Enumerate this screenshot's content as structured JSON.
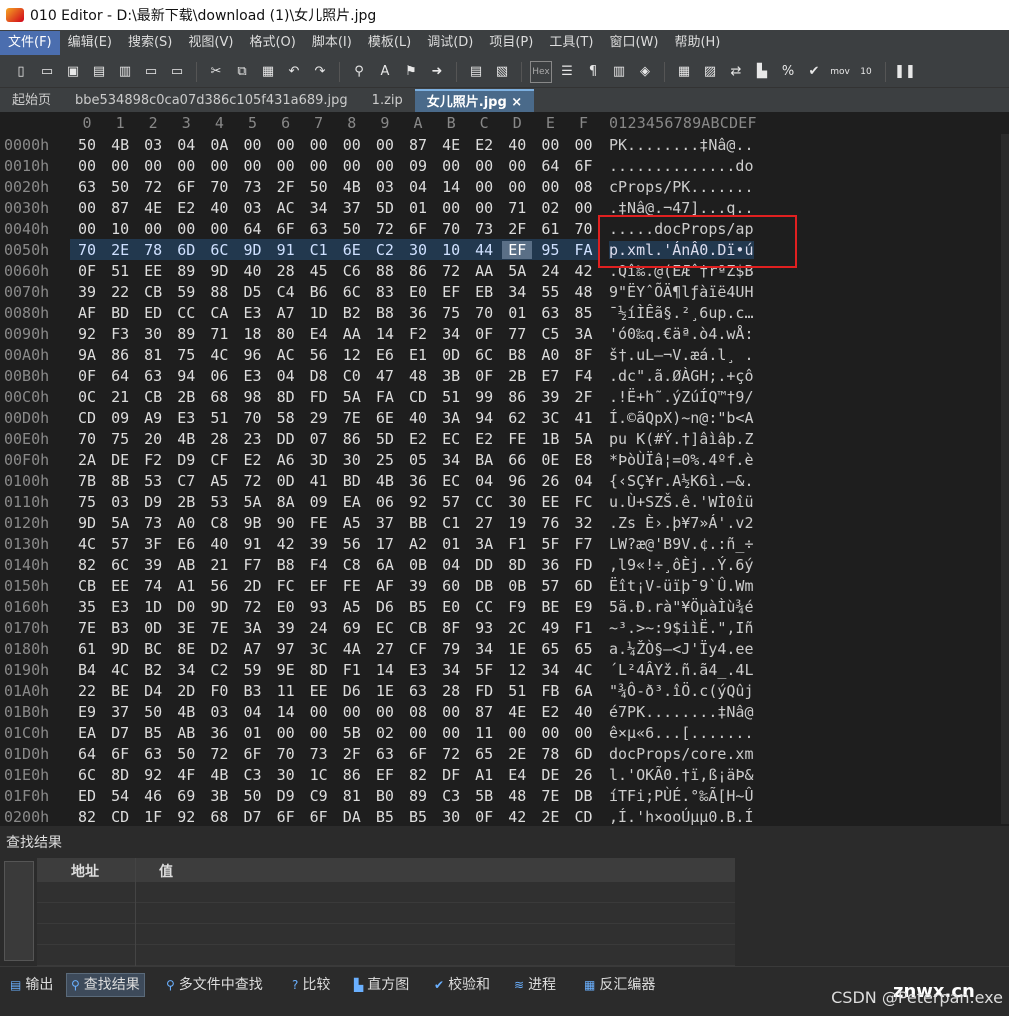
{
  "window_title": "010 Editor - D:\\最新下载\\download (1)\\女儿照片.jpg",
  "menu": [
    "文件(F)",
    "编辑(E)",
    "搜索(S)",
    "视图(V)",
    "格式(O)",
    "脚本(I)",
    "模板(L)",
    "调试(D)",
    "项目(P)",
    "工具(T)",
    "窗口(W)",
    "帮助(H)"
  ],
  "tabs": [
    "起始页",
    "bbe534898c0ca07d386c105f431a689.jpg",
    "1.zip",
    "女儿照片.jpg ×"
  ],
  "column_headers": [
    "0",
    "1",
    "2",
    "3",
    "4",
    "5",
    "6",
    "7",
    "8",
    "9",
    "A",
    "B",
    "C",
    "D",
    "E",
    "F"
  ],
  "ascii_header": "0123456789ABCDEF",
  "rows": [
    {
      "addr": "0000h",
      "hex": [
        "50",
        "4B",
        "03",
        "04",
        "0A",
        "00",
        "00",
        "00",
        "00",
        "00",
        "87",
        "4E",
        "E2",
        "40",
        "00",
        "00"
      ],
      "ascii": "PK........‡Nâ@.."
    },
    {
      "addr": "0010h",
      "hex": [
        "00",
        "00",
        "00",
        "00",
        "00",
        "00",
        "00",
        "00",
        "00",
        "00",
        "09",
        "00",
        "00",
        "00",
        "64",
        "6F"
      ],
      "ascii": "..............do"
    },
    {
      "addr": "0020h",
      "hex": [
        "63",
        "50",
        "72",
        "6F",
        "70",
        "73",
        "2F",
        "50",
        "4B",
        "03",
        "04",
        "14",
        "00",
        "00",
        "00",
        "08"
      ],
      "ascii": "cProps/PK......."
    },
    {
      "addr": "0030h",
      "hex": [
        "00",
        "87",
        "4E",
        "E2",
        "40",
        "03",
        "AC",
        "34",
        "37",
        "5D",
        "01",
        "00",
        "00",
        "71",
        "02",
        "00"
      ],
      "ascii": ".‡Nâ@.¬47]...q.."
    },
    {
      "addr": "0040h",
      "hex": [
        "00",
        "10",
        "00",
        "00",
        "00",
        "64",
        "6F",
        "63",
        "50",
        "72",
        "6F",
        "70",
        "73",
        "2F",
        "61",
        "70"
      ],
      "ascii": ".....docProps/ap"
    },
    {
      "addr": "0050h",
      "hex": [
        "70",
        "2E",
        "78",
        "6D",
        "6C",
        "9D",
        "91",
        "C1",
        "6E",
        "C2",
        "30",
        "10",
        "44",
        "EF",
        "95",
        "FA"
      ],
      "ascii": "p.xml.'ÁnÂ0.Dï•ú"
    },
    {
      "addr": "0060h",
      "hex": [
        "0F",
        "51",
        "EE",
        "89",
        "9D",
        "40",
        "28",
        "45",
        "C6",
        "88",
        "86",
        "72",
        "AA",
        "5A",
        "24",
        "42"
      ],
      "ascii": ".Qî‰.@(EÆˆ†rªZ$B"
    },
    {
      "addr": "0070h",
      "hex": [
        "39",
        "22",
        "CB",
        "59",
        "88",
        "D5",
        "C4",
        "B6",
        "6C",
        "83",
        "E0",
        "EF",
        "EB",
        "34",
        "55",
        "48"
      ],
      "ascii": "9\"ËYˆÕÄ¶lƒàïë4UH"
    },
    {
      "addr": "0080h",
      "hex": [
        "AF",
        "BD",
        "ED",
        "CC",
        "CA",
        "E3",
        "A7",
        "1D",
        "B2",
        "B8",
        "36",
        "75",
        "70",
        "01",
        "63",
        "85"
      ],
      "ascii": "¯½íÌÊã§.²¸6up.c…"
    },
    {
      "addr": "0090h",
      "hex": [
        "92",
        "F3",
        "30",
        "89",
        "71",
        "18",
        "80",
        "E4",
        "AA",
        "14",
        "F2",
        "34",
        "0F",
        "77",
        "C5",
        "3A"
      ],
      "ascii": "'ó0‰q.€äª.ò4.wÅ:"
    },
    {
      "addr": "00A0h",
      "hex": [
        "9A",
        "86",
        "81",
        "75",
        "4C",
        "96",
        "AC",
        "56",
        "12",
        "E6",
        "E1",
        "0D",
        "6C",
        "B8",
        "A0",
        "8F"
      ],
      "ascii": "š†.uL–¬V.æá.l¸ ."
    },
    {
      "addr": "00B0h",
      "hex": [
        "0F",
        "64",
        "63",
        "94",
        "06",
        "E3",
        "04",
        "D8",
        "C0",
        "47",
        "48",
        "3B",
        "0F",
        "2B",
        "E7",
        "F4"
      ],
      "ascii": ".dc\".ã.ØÀGH;.+çô"
    },
    {
      "addr": "00C0h",
      "hex": [
        "0C",
        "21",
        "CB",
        "2B",
        "68",
        "98",
        "8D",
        "FD",
        "5A",
        "FA",
        "CD",
        "51",
        "99",
        "86",
        "39",
        "2F"
      ],
      "ascii": ".!Ë+h˜.ýZúÍQ™†9/"
    },
    {
      "addr": "00D0h",
      "hex": [
        "CD",
        "09",
        "A9",
        "E3",
        "51",
        "70",
        "58",
        "29",
        "7E",
        "6E",
        "40",
        "3A",
        "94",
        "62",
        "3C",
        "41"
      ],
      "ascii": "Í.©ãQpX)~n@:\"b<A"
    },
    {
      "addr": "00E0h",
      "hex": [
        "70",
        "75",
        "20",
        "4B",
        "28",
        "23",
        "DD",
        "07",
        "86",
        "5D",
        "E2",
        "EC",
        "E2",
        "FE",
        "1B",
        "5A"
      ],
      "ascii": "pu K(#Ý.†]âìâþ.Z"
    },
    {
      "addr": "00F0h",
      "hex": [
        "2A",
        "DE",
        "F2",
        "D9",
        "CF",
        "E2",
        "A6",
        "3D",
        "30",
        "25",
        "05",
        "34",
        "BA",
        "66",
        "0E",
        "E8"
      ],
      "ascii": "*ÞòÙÏâ¦=0%.4ºf.è"
    },
    {
      "addr": "0100h",
      "hex": [
        "7B",
        "8B",
        "53",
        "C7",
        "A5",
        "72",
        "0D",
        "41",
        "BD",
        "4B",
        "36",
        "EC",
        "04",
        "96",
        "26",
        "04"
      ],
      "ascii": "{‹SÇ¥r.A½K6ì.–&."
    },
    {
      "addr": "0110h",
      "hex": [
        "75",
        "03",
        "D9",
        "2B",
        "53",
        "5A",
        "8A",
        "09",
        "EA",
        "06",
        "92",
        "57",
        "CC",
        "30",
        "EE",
        "FC"
      ],
      "ascii": "u.Ù+SZŠ.ê.'WÌ0îü"
    },
    {
      "addr": "0120h",
      "hex": [
        "9D",
        "5A",
        "73",
        "A0",
        "C8",
        "9B",
        "90",
        "FE",
        "A5",
        "37",
        "BB",
        "C1",
        "27",
        "19",
        "76",
        "32"
      ],
      "ascii": ".Zs È›.þ¥7»Á'.v2"
    },
    {
      "addr": "0130h",
      "hex": [
        "4C",
        "57",
        "3F",
        "E6",
        "40",
        "91",
        "42",
        "39",
        "56",
        "17",
        "A2",
        "01",
        "3A",
        "F1",
        "5F",
        "F7"
      ],
      "ascii": "LW?æ@'B9V.¢.:ñ_÷"
    },
    {
      "addr": "0140h",
      "hex": [
        "82",
        "6C",
        "39",
        "AB",
        "21",
        "F7",
        "B8",
        "F4",
        "C8",
        "6A",
        "0B",
        "04",
        "DD",
        "8D",
        "36",
        "FD"
      ],
      "ascii": "‚l9«!÷¸ôÈj..Ý.6ý"
    },
    {
      "addr": "0150h",
      "hex": [
        "CB",
        "EE",
        "74",
        "A1",
        "56",
        "2D",
        "FC",
        "EF",
        "FE",
        "AF",
        "39",
        "60",
        "DB",
        "0B",
        "57",
        "6D"
      ],
      "ascii": "Ëît¡V-üïþ¯9`Û.Wm"
    },
    {
      "addr": "0160h",
      "hex": [
        "35",
        "E3",
        "1D",
        "D0",
        "9D",
        "72",
        "E0",
        "93",
        "A5",
        "D6",
        "B5",
        "E0",
        "CC",
        "F9",
        "BE",
        "E9"
      ],
      "ascii": "5ã.Ð.rà\"¥ÖµàÌù¾é"
    },
    {
      "addr": "0170h",
      "hex": [
        "7E",
        "B3",
        "0D",
        "3E",
        "7E",
        "3A",
        "39",
        "24",
        "69",
        "EC",
        "CB",
        "8F",
        "93",
        "2C",
        "49",
        "F1"
      ],
      "ascii": "~³.>~:9$iìË.\",Iñ"
    },
    {
      "addr": "0180h",
      "hex": [
        "61",
        "9D",
        "BC",
        "8E",
        "D2",
        "A7",
        "97",
        "3C",
        "4A",
        "27",
        "CF",
        "79",
        "34",
        "1E",
        "65",
        "65"
      ],
      "ascii": "a.¼ŽÒ§—<J'Ïy4.ee"
    },
    {
      "addr": "0190h",
      "hex": [
        "B4",
        "4C",
        "B2",
        "34",
        "C2",
        "59",
        "9E",
        "8D",
        "F1",
        "14",
        "E3",
        "34",
        "5F",
        "12",
        "34",
        "4C"
      ],
      "ascii": "´L²4ÂYž.ñ.ã4_.4L"
    },
    {
      "addr": "01A0h",
      "hex": [
        "22",
        "BE",
        "D4",
        "2D",
        "F0",
        "B3",
        "11",
        "EE",
        "D6",
        "1E",
        "63",
        "28",
        "FD",
        "51",
        "FB",
        "6A"
      ],
      "ascii": "\"¾Ô-ð³.îÖ.c(ýQûj"
    },
    {
      "addr": "01B0h",
      "hex": [
        "E9",
        "37",
        "50",
        "4B",
        "03",
        "04",
        "14",
        "00",
        "00",
        "00",
        "08",
        "00",
        "87",
        "4E",
        "E2",
        "40"
      ],
      "ascii": "é7PK........‡Nâ@"
    },
    {
      "addr": "01C0h",
      "hex": [
        "EA",
        "D7",
        "B5",
        "AB",
        "36",
        "01",
        "00",
        "00",
        "5B",
        "02",
        "00",
        "00",
        "11",
        "00",
        "00",
        "00"
      ],
      "ascii": "ê×µ«6...[......."
    },
    {
      "addr": "01D0h",
      "hex": [
        "64",
        "6F",
        "63",
        "50",
        "72",
        "6F",
        "70",
        "73",
        "2F",
        "63",
        "6F",
        "72",
        "65",
        "2E",
        "78",
        "6D"
      ],
      "ascii": "docProps/core.xm"
    },
    {
      "addr": "01E0h",
      "hex": [
        "6C",
        "8D",
        "92",
        "4F",
        "4B",
        "C3",
        "30",
        "1C",
        "86",
        "EF",
        "82",
        "DF",
        "A1",
        "E4",
        "DE",
        "26"
      ],
      "ascii": "l.'OKÃ0.†ï‚ß¡äÞ&"
    },
    {
      "addr": "01F0h",
      "hex": [
        "ED",
        "54",
        "46",
        "69",
        "3B",
        "50",
        "D9",
        "C9",
        "81",
        "B0",
        "89",
        "C3",
        "5B",
        "48",
        "7E",
        "DB"
      ],
      "ascii": "íTFi;PÙÉ.°‰Ã[H~Û"
    },
    {
      "addr": "0200h",
      "hex": [
        "82",
        "CD",
        "1F",
        "92",
        "68",
        "D7",
        "6F",
        "6F",
        "DA",
        "B5",
        "B5",
        "30",
        "0F",
        "42",
        "2E",
        "CD"
      ],
      "ascii": "‚Í.'h×ooÚµµ0.B.Í"
    }
  ],
  "find_panel": {
    "title": "查找结果",
    "col_address": "地址",
    "col_value": "值"
  },
  "bottom_tabs": [
    "输出",
    "查找结果",
    "多文件中查找",
    "比较",
    "直方图",
    "校验和",
    "进程",
    "反汇编器"
  ],
  "watermark": "CSDN @Peterpan.exe",
  "watermark2": "znwx.cn"
}
